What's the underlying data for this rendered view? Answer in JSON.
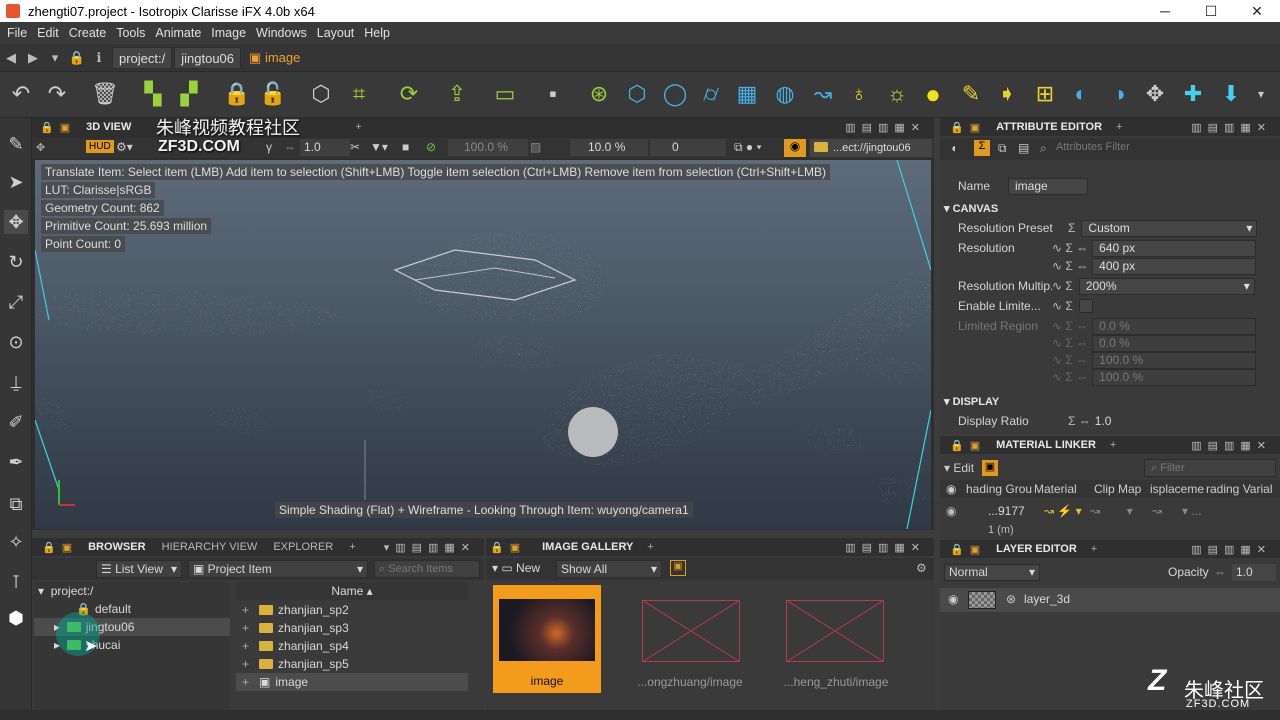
{
  "window": {
    "title": "zhengti07.project - Isotropix Clarisse iFX 4.0b x64",
    "min": "─",
    "max": "☐",
    "close": "✕"
  },
  "menu": [
    "File",
    "Edit",
    "Create",
    "Tools",
    "Animate",
    "Image",
    "Windows",
    "Layout",
    "Help"
  ],
  "path": {
    "root": "project:/",
    "folder": "jingtou06",
    "item": "image"
  },
  "viewport": {
    "tab": "3D VIEW",
    "watermark": "朱峰视频教程社区",
    "watermark_url": "ZF3D.COM",
    "hud": "HUD",
    "zoom_value": "1.0",
    "pct1": "100.0 %",
    "pct2": "10.0 %",
    "num": "0",
    "path_field": "...ect://jingtou06",
    "hint": "Translate Item: Select item (LMB)  Add item to selection (Shift+LMB)  Toggle item selection (Ctrl+LMB)  Remove item from selection (Ctrl+Shift+LMB)",
    "lut": "LUT: Clarisse|sRGB",
    "geometry_count": "Geometry Count: 862",
    "primitive_count": "Primitive Count: 25.693 million",
    "point_count": "Point Count: 0",
    "status": "Simple Shading (Flat) + Wireframe - Looking Through Item: wuyong/camera1"
  },
  "attribute_editor": {
    "tab": "ATTRIBUTE EDITOR",
    "filter_placeholder": "Attributes Filter",
    "name_label": "Name",
    "name_value": "image",
    "canvas_section": "CANVAS",
    "res_preset_label": "Resolution Preset",
    "res_preset_value": "Custom",
    "resolution_label": "Resolution",
    "res_w": "640 px",
    "res_h": "400 px",
    "res_mult_label": "Resolution Multip...",
    "res_mult_value": "200%",
    "enable_limit_label": "Enable Limite...",
    "limited_region_label": "Limited Region",
    "lr1": "0.0 %",
    "lr2": "0.0 %",
    "lr3": "100.0 %",
    "lr4": "100.0 %",
    "display_section": "DISPLAY",
    "display_ratio_label": "Display Ratio",
    "display_ratio_value": "1.0"
  },
  "material_linker": {
    "tab": "MATERIAL LINKER",
    "edit": "Edit",
    "filter_placeholder": "Filter",
    "columns": [
      "hading Grou",
      "Material",
      "Clip Map",
      "isplaceme",
      "rading Varial"
    ],
    "row_value": "...9177",
    "row2": "1 (m)"
  },
  "layer_editor": {
    "tab": "LAYER EDITOR",
    "blend": "Normal",
    "opacity_label": "Opacity",
    "opacity_value": "1.0",
    "layer_name": "layer_3d"
  },
  "browser": {
    "tabs": [
      "BROWSER",
      "HIERARCHY VIEW",
      "EXPLORER"
    ],
    "view_mode": "List View",
    "filter_type": "Project Item",
    "search_placeholder": "Search Items",
    "tree": [
      "project:/",
      "default",
      "jingtou06",
      "shucai"
    ],
    "column": "Name",
    "items": [
      "zhanjian_sp2",
      "zhanjian_sp3",
      "zhanjian_sp4",
      "zhanjian_sp5",
      "image"
    ]
  },
  "gallery": {
    "tab": "IMAGE GALLERY",
    "new": "New",
    "show": "Show All",
    "thumbs": [
      {
        "label": "image"
      },
      {
        "label": "...ongzhuang/image"
      },
      {
        "label": "...heng_zhuti/image"
      }
    ]
  },
  "brand": {
    "logo": "朱峰社区",
    "url": "ZF3D.COM"
  },
  "colors": {
    "accent": "#f0a030",
    "panel": "#3a3a3a",
    "selected": "#f29b1d"
  }
}
